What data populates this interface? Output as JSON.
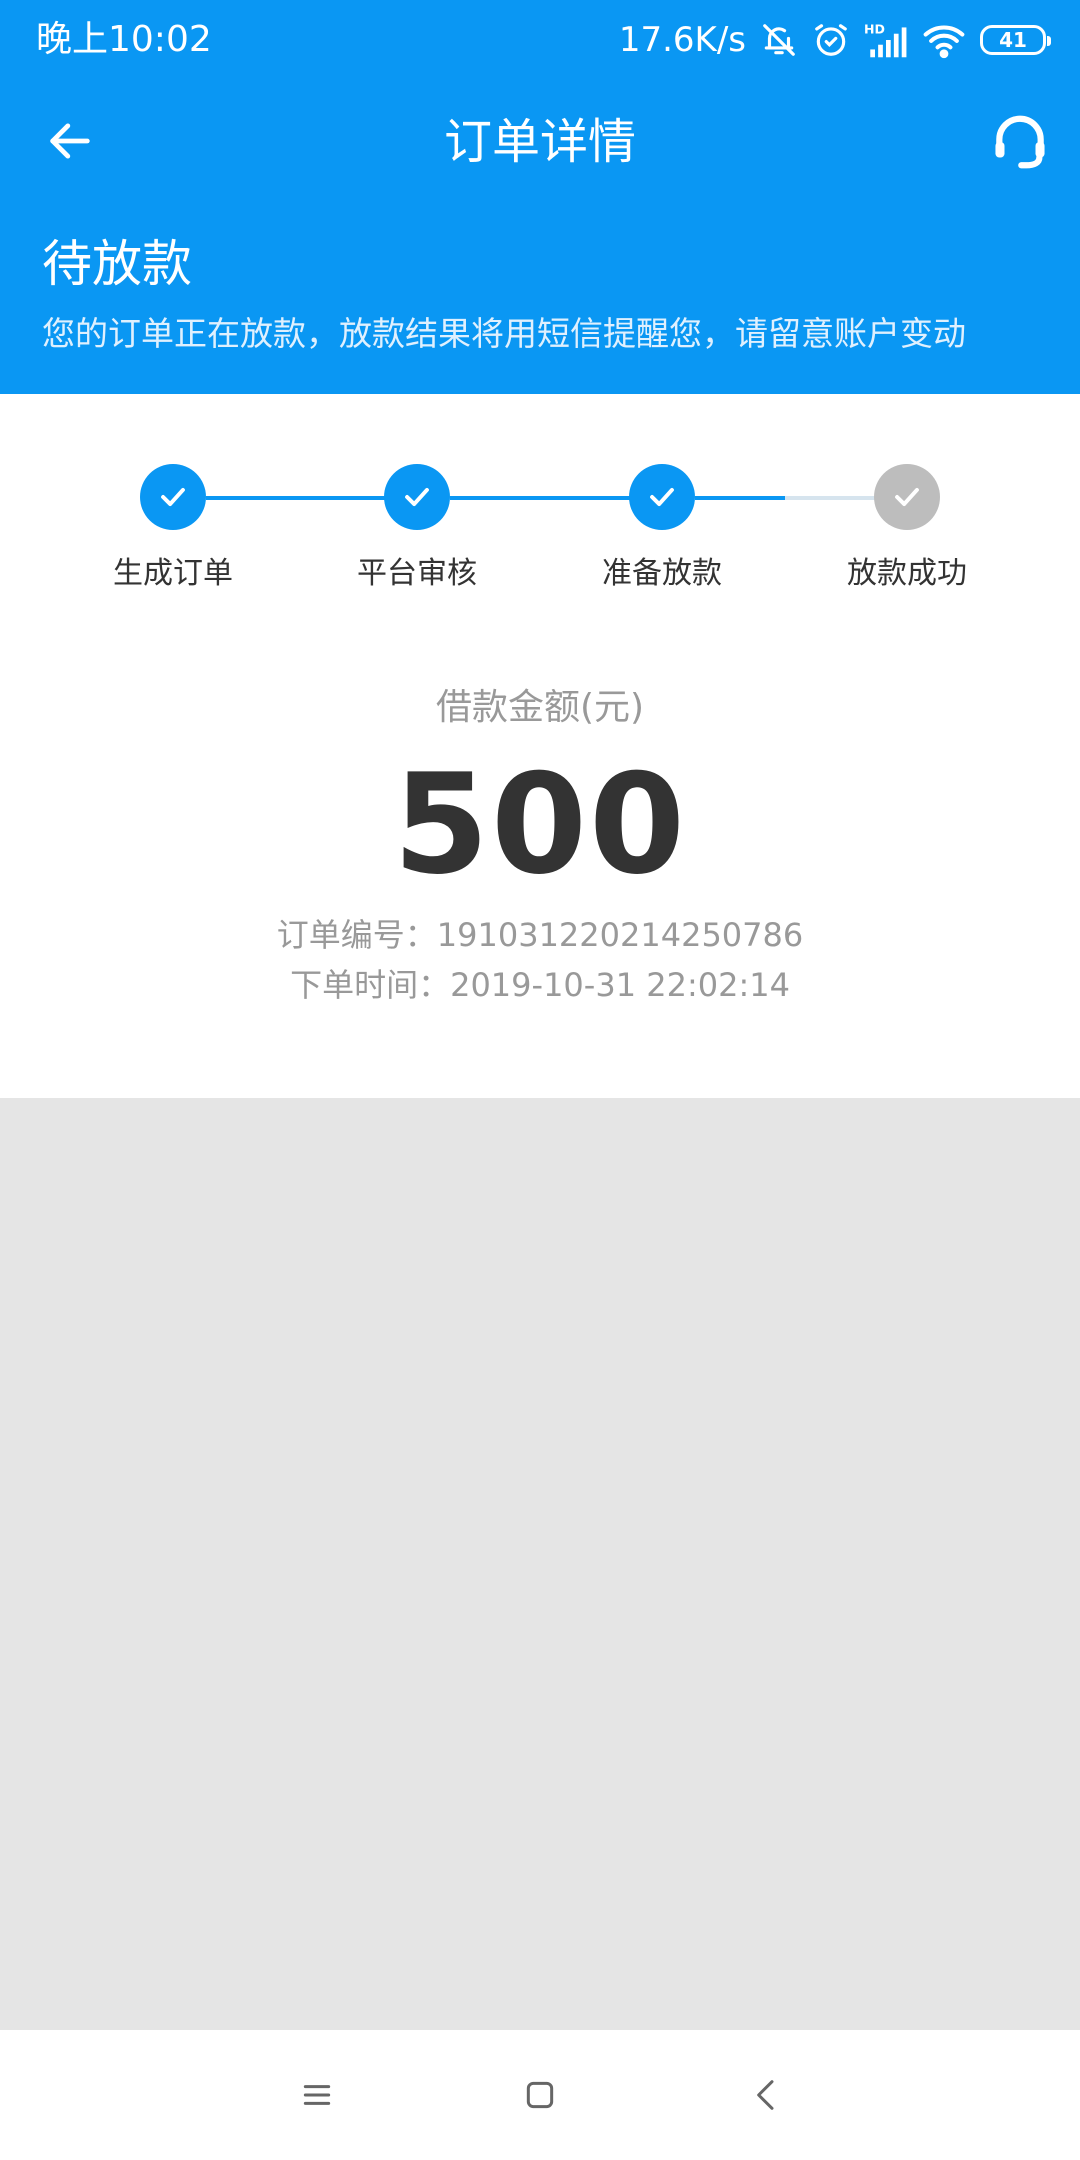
{
  "status_bar": {
    "time": "晚上10:02",
    "speed": "17.6K/s",
    "battery": "41",
    "icons": [
      "notifications-off-icon",
      "alarm-icon",
      "hd-signal-icon",
      "wifi-icon",
      "battery-icon"
    ]
  },
  "nav": {
    "title": "订单详情",
    "back_icon": "arrow-left-icon",
    "service_icon": "headset-icon"
  },
  "status_header": {
    "title": "待放款",
    "description": "您的订单正在放款，放款结果将用短信提醒您，请留意账户变动"
  },
  "steps": [
    {
      "label": "生成订单",
      "done": true
    },
    {
      "label": "平台审核",
      "done": true
    },
    {
      "label": "准备放款",
      "done": true
    },
    {
      "label": "放款成功",
      "done": false
    }
  ],
  "loan": {
    "amount_label": "借款金额(元)",
    "amount": "500",
    "order_no_label": "订单编号：",
    "order_no": "191031220214250786",
    "order_time_label": "下单时间：",
    "order_time": "2019-10-31 22:02:14"
  },
  "colors": {
    "primary": "#0a97f3",
    "step_done": "#0a97f3",
    "step_pending": "#bdbdbd",
    "line_pending": "#d6e4ee",
    "background": "#e5e5e5"
  },
  "bottom_nav": {
    "icons": [
      "menu-icon",
      "home-square-icon",
      "back-chevron-icon"
    ]
  }
}
